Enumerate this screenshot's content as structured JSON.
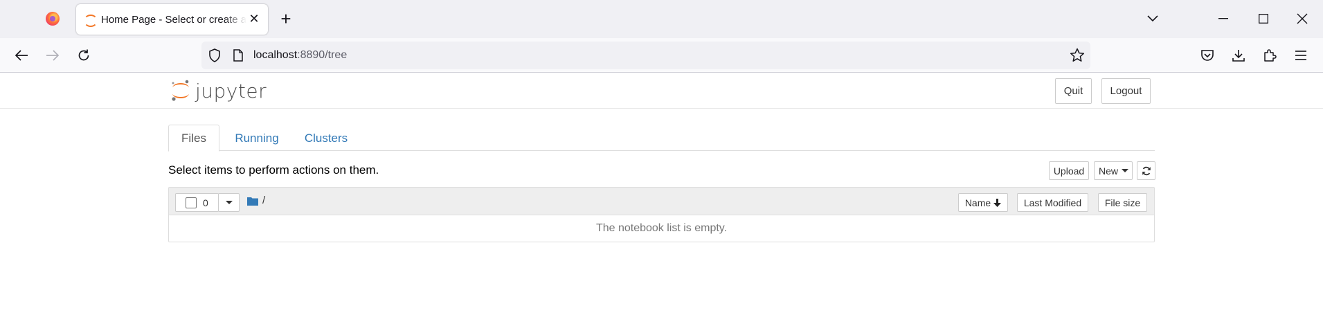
{
  "browser": {
    "tab_title": "Home Page - Select or create a notebook",
    "url_host": "localhost",
    "url_rest": ":8890/tree",
    "icons": {
      "firefox": "firefox-logo-icon",
      "back": "back-arrow-icon",
      "forward": "forward-arrow-icon",
      "reload": "reload-icon",
      "shield": "shield-icon",
      "page": "page-icon",
      "star": "bookmark-star-icon",
      "pocket": "pocket-icon",
      "download": "download-icon",
      "extensions": "extensions-icon",
      "menu": "hamburger-menu-icon"
    }
  },
  "header": {
    "logo_text": "jupyter",
    "quit_label": "Quit",
    "logout_label": "Logout"
  },
  "tabs": [
    {
      "label": "Files"
    },
    {
      "label": "Running"
    },
    {
      "label": "Clusters"
    }
  ],
  "toolbar": {
    "hint": "Select items to perform actions on them.",
    "upload_label": "Upload",
    "new_label": "New"
  },
  "list": {
    "selected_count": "0",
    "path": "/",
    "columns": {
      "name": "Name",
      "last_modified": "Last Modified",
      "file_size": "File size"
    },
    "empty_message": "The notebook list is empty."
  },
  "colors": {
    "jupyter_orange": "#f37726",
    "link_blue": "#337ab7",
    "folder_blue": "#337ab7"
  }
}
